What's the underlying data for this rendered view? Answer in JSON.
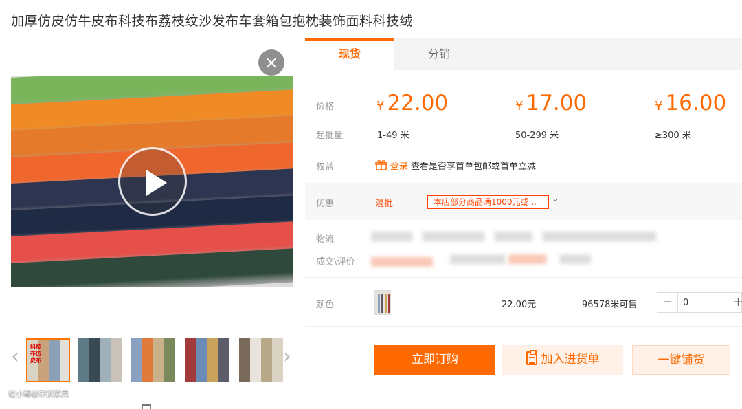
{
  "product": {
    "title": "加厚仿皮仿牛皮布科技布荔枝纹沙发布车套箱包抱枕装饰面料科技绒"
  },
  "media": {
    "stripe_colors": [
      "#7ab55c",
      "#f08a24",
      "#e57a2a",
      "#f0672e",
      "#2e3550",
      "#1f2a44",
      "#e5504a",
      "#2f4a3c"
    ],
    "close_icon": "×",
    "thumb_first_label": "科技布仿皮布",
    "thumbs": [
      {
        "colors": [
          "#d9d3c4",
          "#c7a27a",
          "#8aa1b8",
          "#e3e0da"
        ]
      },
      {
        "colors": [
          "#5e7a85",
          "#3a4a55",
          "#9fb0b8",
          "#c8c2b8"
        ]
      },
      {
        "colors": [
          "#8aa1c2",
          "#e07a3a",
          "#c9b28a",
          "#7a8a5c"
        ]
      },
      {
        "colors": [
          "#a33a3a",
          "#6b8db5",
          "#c9a25c",
          "#5c5c6b"
        ]
      },
      {
        "colors": [
          "#7a6a5c",
          "#e8e4dc",
          "#b8a88a",
          "#d9d3c4"
        ]
      }
    ],
    "prev_arrow": "‹",
    "next_arrow": "›",
    "watermark": "在小帮@宋祯家具"
  },
  "tabs": {
    "active": "现货",
    "other": "分销"
  },
  "labels": {
    "price": "价格",
    "moq": "起批量",
    "rights": "权益",
    "promo": "优惠",
    "logistics": "物流",
    "deals": "成交\\评价",
    "color": "颜色"
  },
  "prices": [
    {
      "currency": "¥",
      "amount": "22.00",
      "range": "1-49 米"
    },
    {
      "currency": "¥",
      "amount": "17.00",
      "range": "50-299 米"
    },
    {
      "currency": "¥",
      "amount": "16.00",
      "range": "≥300 米"
    }
  ],
  "rights": {
    "login_link": "登录",
    "text": "查看是否享首单包邮或首单立减"
  },
  "promo": {
    "tag": "混批",
    "detail": "本店部分商品满1000元或...",
    "chevron_icon": "⌄"
  },
  "color_option": {
    "price": "22.00元",
    "stock": "96578米可售"
  },
  "quantity": {
    "value": "0",
    "minus": "−",
    "plus": "+"
  },
  "buttons": {
    "buy": "立即订购",
    "cart": "加入进货单",
    "distribute": "一键铺货"
  },
  "colors": {
    "accent": "#ff6a00",
    "promo_red": "#ff4400"
  }
}
